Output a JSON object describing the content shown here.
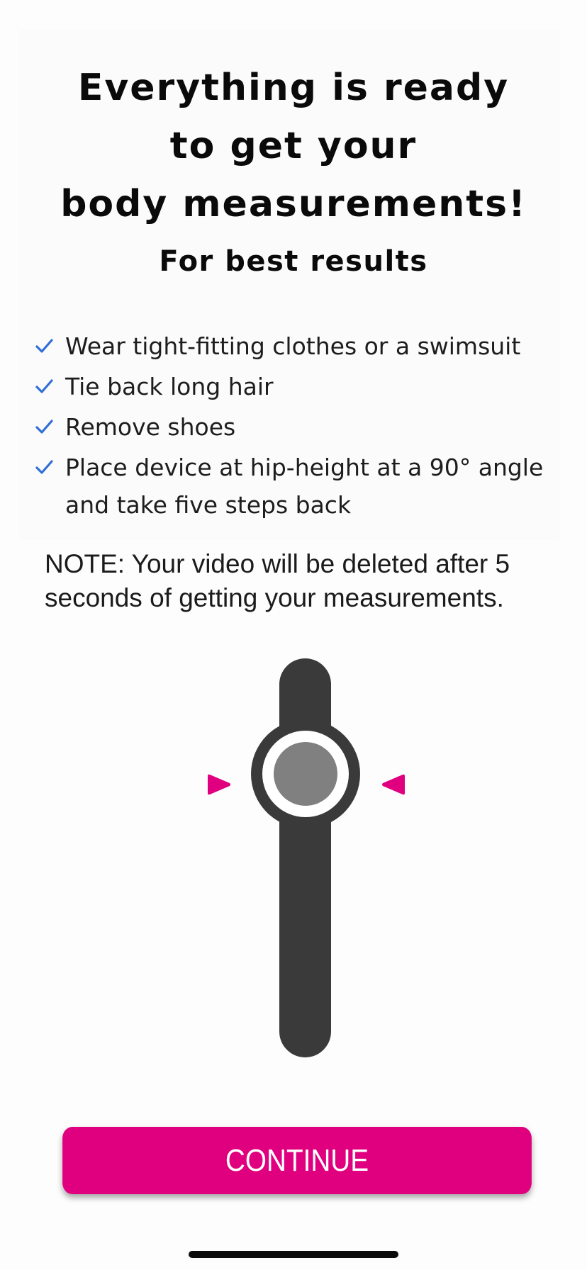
{
  "header": {
    "title_lines": [
      "Everything is ready",
      "to get your",
      "body measurements!"
    ]
  },
  "tips": {
    "heading": "For best results",
    "check_color": "#2f6fd6",
    "items": [
      {
        "icon": "checkmark-icon",
        "label": "Wear tight-fitting clothes or a swimsuit"
      },
      {
        "icon": "checkmark-icon",
        "label": "Tie back long hair"
      },
      {
        "icon": "checkmark-icon",
        "label": "Remove shoes"
      },
      {
        "icon": "checkmark-icon",
        "label": "Place device at hip-height at a 90° angle and take five steps back"
      }
    ]
  },
  "note": {
    "text": "NOTE: Your video will be deleted after 5 seconds of getting your measurements."
  },
  "level_indicator": {
    "track_color": "#3a3a3a",
    "knob_color": "#808080",
    "arrow_color": "#e0007f",
    "icons": [
      "left-pointer-icon",
      "right-pointer-icon"
    ]
  },
  "actions": {
    "continue_label": "CONTINUE",
    "accent_color": "#e0007f"
  }
}
